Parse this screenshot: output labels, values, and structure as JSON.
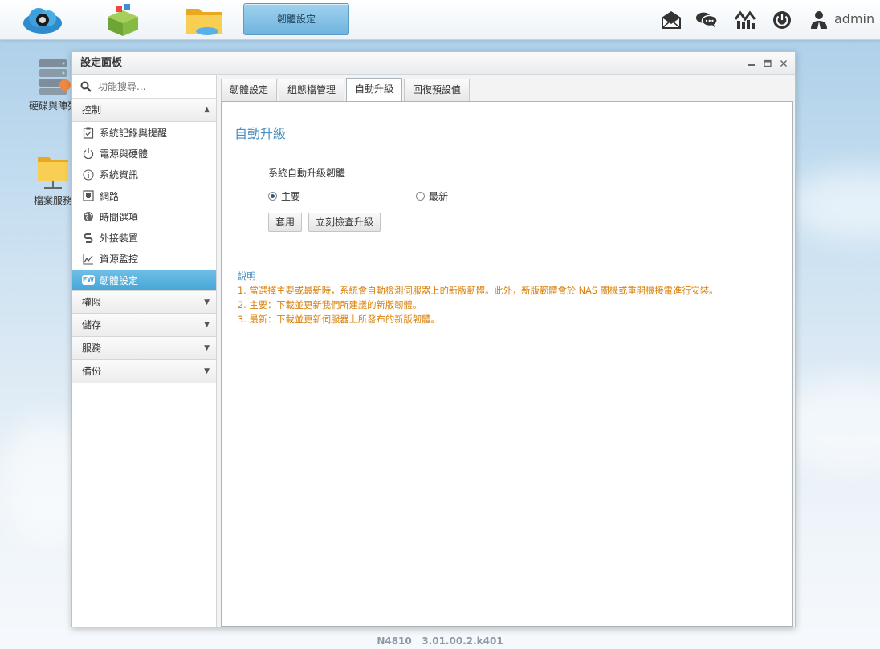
{
  "taskbar": {
    "active_window_label": "韌體設定",
    "user": "admin"
  },
  "desktop": {
    "icons": [
      {
        "label": "硬碟與陣列"
      },
      {
        "label": "檔案服務"
      }
    ]
  },
  "window": {
    "title": "設定面板"
  },
  "sidebar": {
    "search_placeholder": "功能搜尋...",
    "sections": [
      {
        "label": "控制",
        "expanded": true
      },
      {
        "label": "權限"
      },
      {
        "label": "儲存"
      },
      {
        "label": "服務"
      },
      {
        "label": "備份"
      }
    ],
    "items": [
      {
        "label": "系統記錄與提醒",
        "icon": "clipboard-check-icon"
      },
      {
        "label": "電源與硬體",
        "icon": "power-icon"
      },
      {
        "label": "系統資訊",
        "icon": "info-icon"
      },
      {
        "label": "網路",
        "icon": "network-port-icon"
      },
      {
        "label": "時間選項",
        "icon": "globe-icon"
      },
      {
        "label": "外接裝置",
        "icon": "usb-device-icon"
      },
      {
        "label": "資源監控",
        "icon": "line-chart-icon"
      },
      {
        "label": "韌體設定",
        "icon": "fw-badge-icon",
        "active": true
      }
    ],
    "fw_badge": "FW"
  },
  "tabs": [
    {
      "label": "韌體設定"
    },
    {
      "label": "組態檔管理"
    },
    {
      "label": "自動升級",
      "active": true
    },
    {
      "label": "回復預設值"
    }
  ],
  "panel": {
    "title": "自動升級",
    "option_label": "系統自動升級韌體",
    "radio_main": "主要",
    "radio_latest": "最新",
    "selected": "主要",
    "apply_button": "套用",
    "check_button": "立刻檢查升級",
    "note": {
      "title": "說明",
      "lines": [
        "1. 當選擇主要或最新時，系統會自動檢測伺服器上的新版韌體。此外，新版韌體會於 NAS 關機或重開機接電進行安裝。",
        "2. 主要：下載並更新我們所建議的新版韌體。",
        "3. 最新：下載並更新伺服器上所發布的新版韌體。"
      ]
    }
  },
  "footer": {
    "model": "N4810",
    "version": "3.01.00.2.k401"
  }
}
